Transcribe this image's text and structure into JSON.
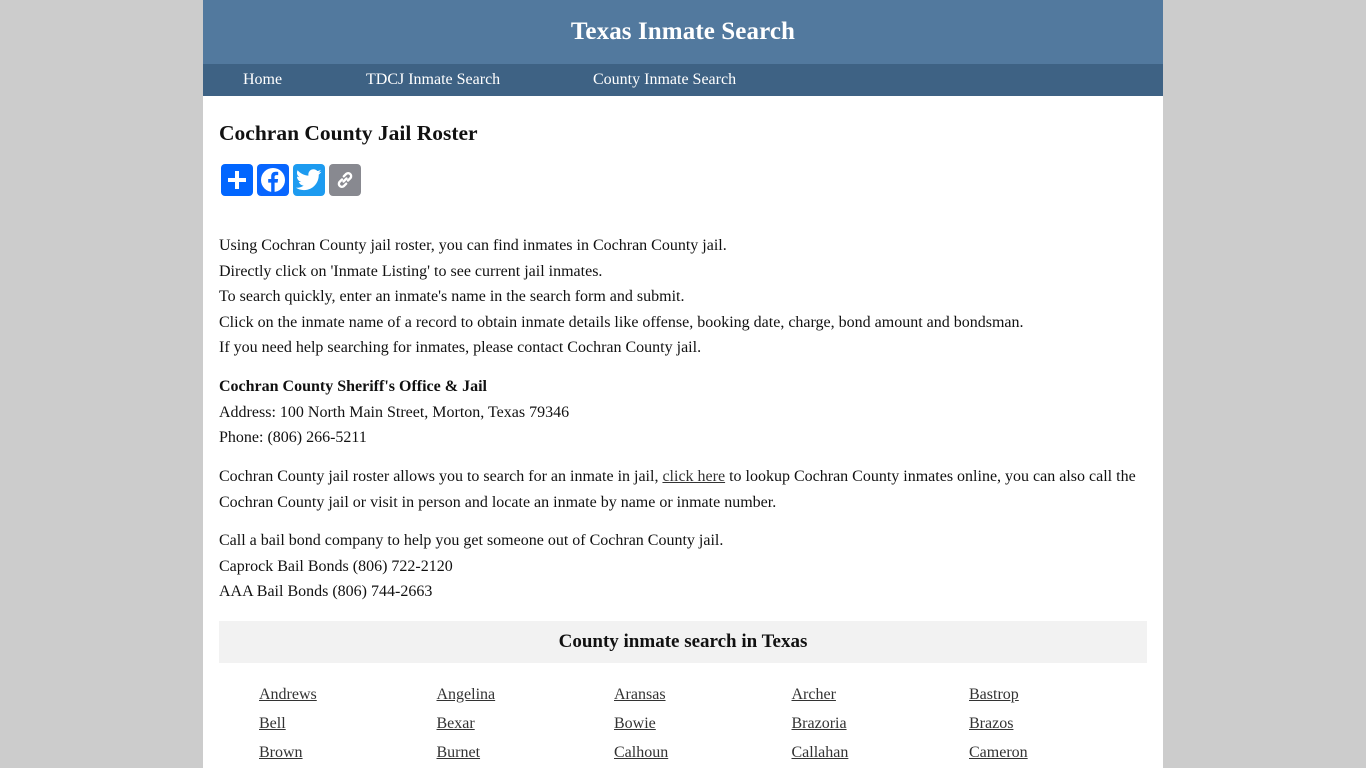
{
  "header": {
    "site_title": "Texas Inmate Search"
  },
  "nav": {
    "items": [
      {
        "label": "Home"
      },
      {
        "label": "TDCJ Inmate Search"
      },
      {
        "label": "County Inmate Search"
      }
    ]
  },
  "main": {
    "page_title": "Cochran County Jail Roster",
    "share_buttons": [
      {
        "name": "share",
        "icon": "plus-icon",
        "color": "#0166ff"
      },
      {
        "name": "facebook",
        "icon": "facebook-icon",
        "color": "#0866ff"
      },
      {
        "name": "twitter",
        "icon": "twitter-icon",
        "color": "#1d9bf0"
      },
      {
        "name": "copy-link",
        "icon": "link-icon",
        "color": "#888990"
      }
    ],
    "intro_lines": [
      "Using Cochran County jail roster, you can find inmates in Cochran County jail.",
      "Directly click on 'Inmate Listing' to see current jail inmates.",
      "To search quickly, enter an inmate's name in the search form and submit.",
      "Click on the inmate name of a record to obtain inmate details like offense, booking date, charge, bond amount and bondsman.",
      "If you need help searching for inmates, please contact Cochran County jail."
    ],
    "office": {
      "name": "Cochran County Sheriff's Office & Jail",
      "address": "Address: 100 North Main Street, Morton, Texas 79346",
      "phone": "Phone: (806) 266-5211"
    },
    "lookup": {
      "before_link": "Cochran County jail roster allows you to search for an inmate in jail, ",
      "link_text": "click here",
      "after_link": " to lookup Cochran County inmates online, you can also call the Cochran County jail or visit in person and locate an inmate by name or inmate number."
    },
    "bail": {
      "intro": "Call a bail bond company to help you get someone out of Cochran County jail.",
      "companies": [
        "Caprock Bail Bonds (806) 722-2120",
        "AAA Bail Bonds (806) 744-2663"
      ]
    },
    "counties_section": {
      "title": "County inmate search in Texas",
      "counties": [
        "Andrews",
        "Angelina",
        "Aransas",
        "Archer",
        "Bastrop",
        "Bell",
        "Bexar",
        "Bowie",
        "Brazoria",
        "Brazos",
        "Brown",
        "Burnet",
        "Calhoun",
        "Callahan",
        "Cameron"
      ]
    }
  },
  "colors": {
    "page_background": "#cccccc",
    "header_background": "#52799e",
    "nav_background": "#3e6284",
    "section_background": "#f2f2f2"
  }
}
